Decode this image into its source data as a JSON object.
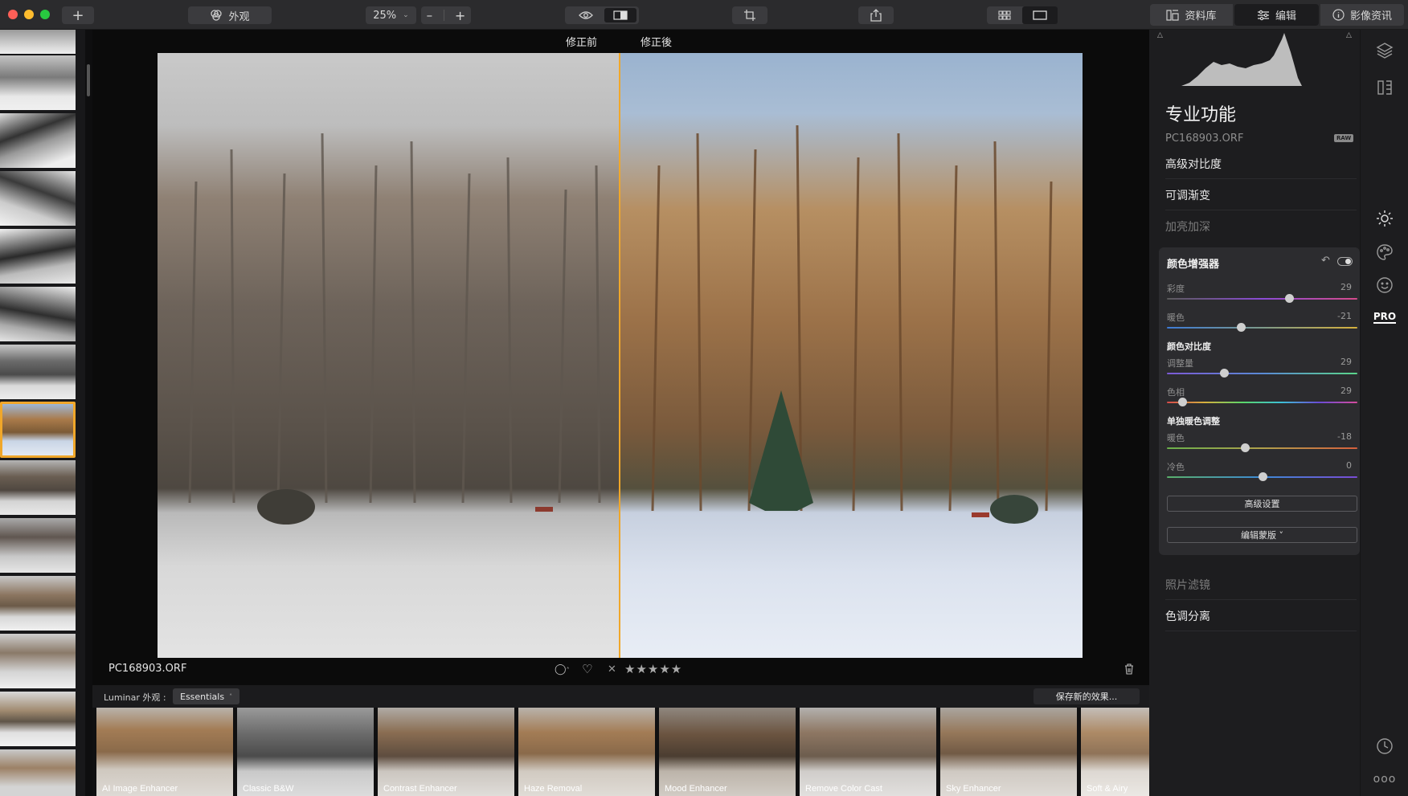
{
  "toolbar": {
    "add_icon": "plus-icon",
    "looks_label": "外观",
    "zoom_value": "25%",
    "zoom_minus": "–",
    "zoom_plus": "+",
    "tabs": {
      "library": "资料库",
      "edit": "编辑",
      "info": "影像资讯"
    }
  },
  "viewer": {
    "before_label": "修正前",
    "after_label": "修正後",
    "filename": "PC168903.ORF",
    "rating": "★★★★★",
    "reject": "✕"
  },
  "looks": {
    "prefix": "Luminar 外观 :",
    "collection": "Essentials",
    "save_button": "保存新的效果...",
    "items": [
      "AI Image Enhancer",
      "Classic B&W",
      "Contrast Enhancer",
      "Haze Removal",
      "Mood Enhancer",
      "Remove Color Cast",
      "Sky Enhancer",
      "Soft & Airy"
    ]
  },
  "panel": {
    "title": "专业功能",
    "file_name": "PC168903.ORF",
    "raw_badge": "RAW",
    "tools_above": [
      "高级对比度",
      "可调渐变",
      "加亮加深"
    ],
    "active_tool": {
      "title": "颜色增强器",
      "sliders": [
        {
          "label": "彩度",
          "value": "29",
          "pos": 0.64
        },
        {
          "label": "暖色",
          "value": "-21",
          "pos": 0.39
        },
        {
          "section": "颜色对比度"
        },
        {
          "label": "调整量",
          "value": "29",
          "pos": 0.3
        },
        {
          "label": "色相",
          "value": "29",
          "pos": 0.08
        },
        {
          "section": "单独暖色调整"
        },
        {
          "label": "暖色",
          "value": "-18",
          "pos": 0.41
        },
        {
          "label": "冷色",
          "value": "0",
          "pos": 0.5
        }
      ],
      "advanced_button": "高级设置",
      "mask_button": "编辑蒙版 ˅"
    },
    "tools_below": [
      "照片滤镜",
      "色调分离"
    ],
    "pro_label": "PRO"
  },
  "colors": {
    "accent": "#f0a72a",
    "panel_bg": "#1d1d1f",
    "card_bg": "#2c2c2f"
  }
}
